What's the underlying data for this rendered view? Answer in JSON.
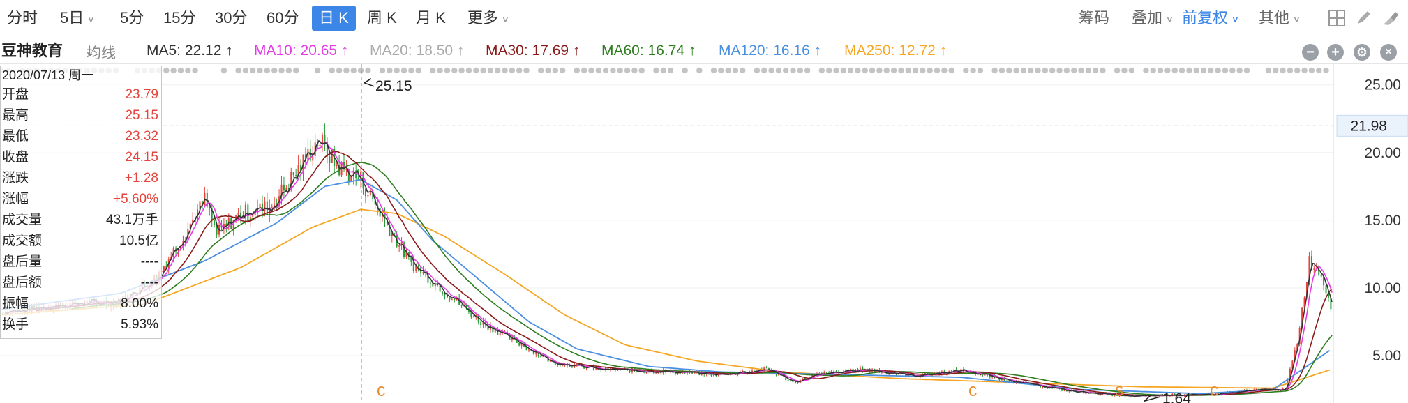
{
  "toolbar": {
    "periods": [
      {
        "label": "分时",
        "dropdown": false,
        "active": false
      },
      {
        "label": "5日",
        "dropdown": true,
        "active": false
      },
      {
        "label": "5分",
        "dropdown": false,
        "active": false
      },
      {
        "label": "15分",
        "dropdown": false,
        "active": false
      },
      {
        "label": "30分",
        "dropdown": false,
        "active": false
      },
      {
        "label": "60分",
        "dropdown": false,
        "active": false
      },
      {
        "label": "日 K",
        "dropdown": false,
        "active": true
      },
      {
        "label": "周 K",
        "dropdown": false,
        "active": false
      },
      {
        "label": "月 K",
        "dropdown": false,
        "active": false
      },
      {
        "label": "更多",
        "dropdown": true,
        "active": false
      }
    ],
    "right": {
      "chips": "筹码",
      "overlay": "叠加",
      "adjust": "前复权",
      "other": "其他"
    },
    "icons": [
      "grid-icon",
      "pen-icon",
      "clear-icon"
    ]
  },
  "stock": {
    "name": "豆神教育",
    "avg_label": "均线"
  },
  "ma": [
    {
      "label": "MA5: 22.12 ↑",
      "color": "#333333"
    },
    {
      "label": "MA10: 20.65 ↑",
      "color": "#e33be6"
    },
    {
      "label": "MA20: 18.50 ↑",
      "color": "#aaaaaa"
    },
    {
      "label": "MA30: 17.69 ↑",
      "color": "#8b1a1a"
    },
    {
      "label": "MA60: 16.74 ↑",
      "color": "#2e7d1e"
    },
    {
      "label": "MA120: 16.16 ↑",
      "color": "#4a8fe0"
    },
    {
      "label": "MA250: 12.72 ↑",
      "color": "#f5a623"
    }
  ],
  "window_controls": [
    "minus-icon",
    "plus-icon",
    "gear-icon",
    "close-icon"
  ],
  "info": {
    "date": "2020/07/13 周一",
    "rows": [
      {
        "k": "开盘",
        "v": "23.79",
        "red": true
      },
      {
        "k": "最高",
        "v": "25.15",
        "red": true
      },
      {
        "k": "最低",
        "v": "23.32",
        "red": true
      },
      {
        "k": "收盘",
        "v": "24.15",
        "red": true
      },
      {
        "k": "涨跌",
        "v": "+1.28",
        "red": true
      },
      {
        "k": "涨幅",
        "v": "+5.60%",
        "red": true
      },
      {
        "k": "成交量",
        "v": "43.1万手",
        "red": false
      },
      {
        "k": "成交额",
        "v": "10.5亿",
        "red": false
      },
      {
        "k": "盘后量",
        "v": "----",
        "red": false
      },
      {
        "k": "盘后额",
        "v": "----",
        "red": false
      },
      {
        "k": "振幅",
        "v": "8.00%",
        "red": false
      },
      {
        "k": "换手",
        "v": "5.93%",
        "red": false
      }
    ]
  },
  "colors": {
    "up": "#e5433b",
    "down": "#2a9d3a",
    "ma5": "#333333",
    "ma10": "#e33be6",
    "ma20": "#aaaaaa",
    "ma30": "#8b1a1a",
    "ma60": "#2e7d1e",
    "ma120": "#4a8fe0",
    "ma250": "#f5a623",
    "marker": "#e58a2b",
    "crosshair_label_bg": "#eaf2fc"
  },
  "chart_data": {
    "type": "line",
    "ylim": [
      1.5,
      25.5
    ],
    "y_ticks": [
      "25.00",
      "20.00",
      "15.00",
      "10.00",
      "5.00"
    ],
    "crosshair_value": "21.98",
    "high_annotation": "25.15",
    "low_annotation": "1.64",
    "event_markers": [
      "C",
      "C",
      "S",
      "C"
    ],
    "price_path": [
      [
        0,
        8.2
      ],
      [
        60,
        8.8
      ],
      [
        100,
        9.0
      ],
      [
        130,
        10.8
      ],
      [
        150,
        13.5
      ],
      [
        170,
        16.5
      ],
      [
        180,
        14.0
      ],
      [
        200,
        15.5
      ],
      [
        225,
        16.0
      ],
      [
        250,
        19.0
      ],
      [
        265,
        21.0
      ],
      [
        280,
        19.0
      ],
      [
        300,
        18.0
      ],
      [
        320,
        15.0
      ],
      [
        340,
        12.0
      ],
      [
        360,
        10.5
      ],
      [
        380,
        9.0
      ],
      [
        400,
        7.5
      ],
      [
        430,
        6.0
      ],
      [
        460,
        4.5
      ],
      [
        500,
        4.0
      ],
      [
        560,
        3.8
      ],
      [
        600,
        3.6
      ],
      [
        640,
        4.0
      ],
      [
        660,
        3.0
      ],
      [
        680,
        3.6
      ],
      [
        720,
        4.0
      ],
      [
        760,
        3.5
      ],
      [
        800,
        3.9
      ],
      [
        850,
        3.0
      ],
      [
        890,
        2.4
      ],
      [
        940,
        2.0
      ],
      [
        970,
        2.1
      ],
      [
        1000,
        2.1
      ],
      [
        1030,
        2.3
      ],
      [
        1050,
        2.5
      ],
      [
        1070,
        2.5
      ],
      [
        1080,
        6.0
      ],
      [
        1090,
        12.0
      ],
      [
        1100,
        11.0
      ],
      [
        1109,
        8.5
      ]
    ],
    "ma_series": [
      {
        "name": "MA120",
        "values": [
          [
            0,
            8.4
          ],
          [
            100,
            9.6
          ],
          [
            170,
            12.0
          ],
          [
            230,
            14.8
          ],
          [
            270,
            17.5
          ],
          [
            300,
            18.0
          ],
          [
            330,
            16.5
          ],
          [
            360,
            13.5
          ],
          [
            400,
            10.5
          ],
          [
            440,
            7.5
          ],
          [
            480,
            5.5
          ],
          [
            540,
            4.2
          ],
          [
            600,
            3.8
          ],
          [
            700,
            3.6
          ],
          [
            800,
            3.4
          ],
          [
            900,
            2.5
          ],
          [
            1000,
            2.2
          ],
          [
            1060,
            2.5
          ],
          [
            1109,
            5.5
          ]
        ]
      },
      {
        "name": "MA250",
        "values": [
          [
            0,
            8.0
          ],
          [
            120,
            8.8
          ],
          [
            200,
            11.5
          ],
          [
            260,
            14.5
          ],
          [
            300,
            15.8
          ],
          [
            330,
            15.5
          ],
          [
            370,
            13.8
          ],
          [
            420,
            11.0
          ],
          [
            470,
            8.0
          ],
          [
            520,
            5.8
          ],
          [
            580,
            4.6
          ],
          [
            650,
            3.8
          ],
          [
            750,
            3.3
          ],
          [
            850,
            3.0
          ],
          [
            950,
            2.7
          ],
          [
            1060,
            2.6
          ],
          [
            1109,
            4.0
          ]
        ]
      }
    ]
  }
}
